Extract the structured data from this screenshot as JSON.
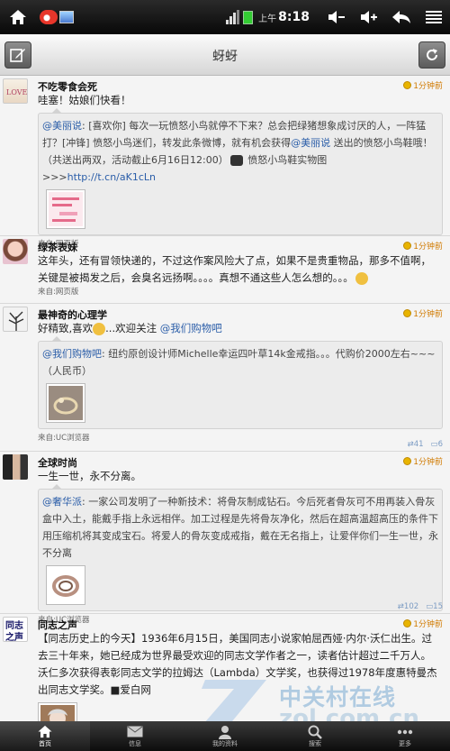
{
  "statusbar": {
    "ampm": "上午",
    "time": "8:18"
  },
  "titlebar": {
    "title": "蚜蚜"
  },
  "posts": [
    {
      "user": "不吃零食会死",
      "time": "1分钟前",
      "text": "哇塞！姑娘们快看！",
      "quote": {
        "author": "@美丽说",
        "text": "[喜欢你] 每次一玩愤怒小鸟就停不下来？总会把绿猪想象成讨厌的人，一阵猛打？[冲锋] 愤怒小鸟迷们，转发此条微博，就有机会获得",
        "mention": "@美丽说",
        "text2": " 送出的愤怒小鸟鞋哦！（共送出两双，活动截止6月16日12:00）",
        "text3": " 愤怒小鸟鞋实物图>>>",
        "url": "http://t.cn/aK1cLn"
      },
      "source": "来自:网页版"
    },
    {
      "user": "绿茶表妹",
      "time": "1分钟前",
      "text": "这年头，还有冒领快递的，不过这作案风险大了点，如果不是贵重物品，那多不值啊，关键是被揭发之后，会臭名远扬啊。。。。真想不通这些人怎么想的。。。",
      "source": "来自:网页版"
    },
    {
      "user": "最神奇的心理学",
      "time": "1分钟前",
      "text": "好精致,喜欢",
      "text2": "...欢迎关注 ",
      "mention": "@我们购物吧",
      "quote": {
        "author": "@我们购物吧",
        "text": ": 纽约原创设计师Michelle幸运四叶草14k金戒指。。。代购价2000左右~~~（人民币）"
      },
      "source": "来自:UC浏览器",
      "reposts": "41",
      "comments": "6"
    },
    {
      "user": "全球时尚",
      "time": "1分钟前",
      "text": "一生一世，永不分离。",
      "quote": {
        "author": "@奢华派",
        "text": ": 一家公司发明了一种新技术：将骨灰制成钻石。今后死者骨灰可不用再装入骨灰盒中入土，能戴手指上永远相伴。加工过程是先将骨灰净化，然后在超高温超高压的条件下用压缩机将其变成宝石。将爱人的骨灰变成戒指，戴在无名指上，让爱伴你们一生一世，永不分离"
      },
      "source": "来自:UC浏览器",
      "reposts": "102",
      "comments": "15"
    },
    {
      "user": "同志之声",
      "time": "1分钟前",
      "text": "【同志历史上的今天】1936年6月15日，美国同志小说家帕屈西娅·内尔·沃仁出生。过去三十年来，她已经成为世界最受欢迎的同志文学作者之一，读者估计超过二千万人。沃仁多次获得表彰同志文学的拉姆达（Lambda）文学奖，也获得过1978年度惠特曼杰出同志文学奖。■爱白网"
    }
  ],
  "nav": [
    {
      "label": "首页"
    },
    {
      "label": "信息"
    },
    {
      "label": "我的资料"
    },
    {
      "label": "搜索"
    },
    {
      "label": "更多"
    }
  ],
  "watermark": {
    "text": "中关村在线",
    "url": "zol.com.cn"
  }
}
